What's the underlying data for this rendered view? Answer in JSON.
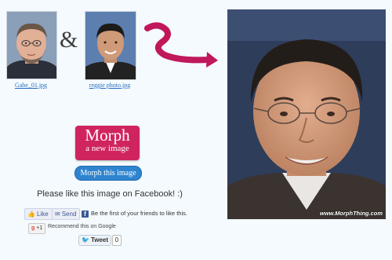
{
  "sources": {
    "left": {
      "filename": "Gabe_01.jpg",
      "icon": "portrait-icon"
    },
    "right": {
      "filename": "reggie photo.jpg",
      "icon": "portrait-icon"
    },
    "joiner": "&"
  },
  "morph": {
    "logo_big": "Morph",
    "logo_small": "a new image",
    "button_label": "Morph this image"
  },
  "social": {
    "prompt": "Please like this image on Facebook! :)",
    "like_label": "Like",
    "send_label": "Send",
    "fb_text": "Be the first of your friends to like this.",
    "gplus_label": "+1",
    "gplus_text": "Recommend this on Google",
    "tweet_label": "Tweet",
    "tweet_count": "0"
  },
  "result": {
    "watermark": "www.MorphThing.com"
  },
  "colors": {
    "accent_pink": "#d0245f",
    "button_blue": "#2f84cf",
    "arrow_pink": "#c0185a"
  }
}
